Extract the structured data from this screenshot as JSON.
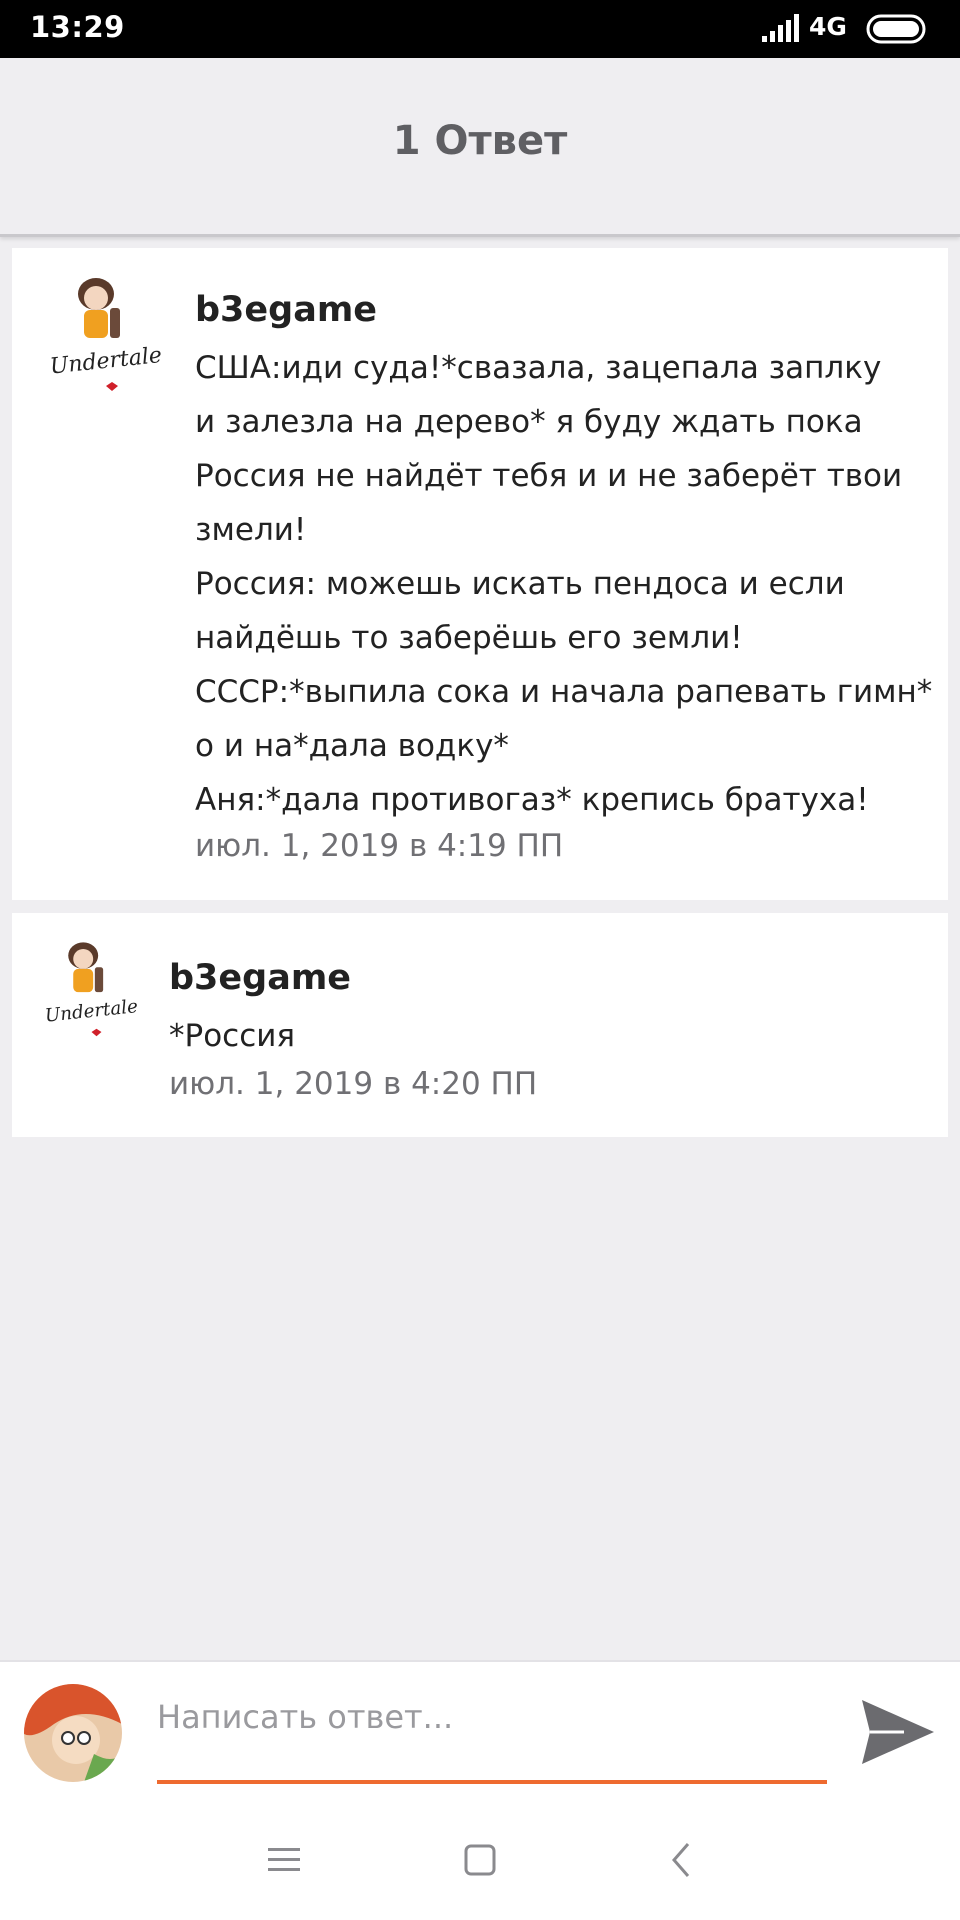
{
  "status_bar": {
    "time": "13:29",
    "network": "4G",
    "icons": [
      "signal-icon",
      "battery-icon"
    ]
  },
  "header": {
    "title": "1 Ответ"
  },
  "replies": [
    {
      "username": "b3egame",
      "avatar_text": "Undertale",
      "message_lines": [
        "США:иди суда!*свазала, зацепала заплку",
        "и залезла на дерево* я буду ждать пока",
        "Россия не найдёт тебя и и не заберёт твои",
        "змели!",
        "Россия: можешь искать пендоса и если",
        "найдёшь то заберёшь его земли!",
        "СССР:*выпила сока и начала рапевать гимн*",
        "о и на*дала водку*",
        "Аня:*дала противогаз* крепись братуха!"
      ],
      "timestamp": "июл. 1, 2019 в 4:19 ПП"
    },
    {
      "username": "b3egame",
      "avatar_text": "Undertale",
      "message_lines": [
        "*Россия"
      ],
      "timestamp": "июл. 1, 2019 в 4:20 ПП"
    }
  ],
  "reply_bar": {
    "placeholder": "Написать ответ...",
    "value": "",
    "accent_color": "#ee6a2f",
    "icons": [
      "user-avatar",
      "send-icon"
    ]
  },
  "nav_bar": {
    "icons": [
      "menu-icon",
      "home-icon",
      "back-icon"
    ]
  }
}
